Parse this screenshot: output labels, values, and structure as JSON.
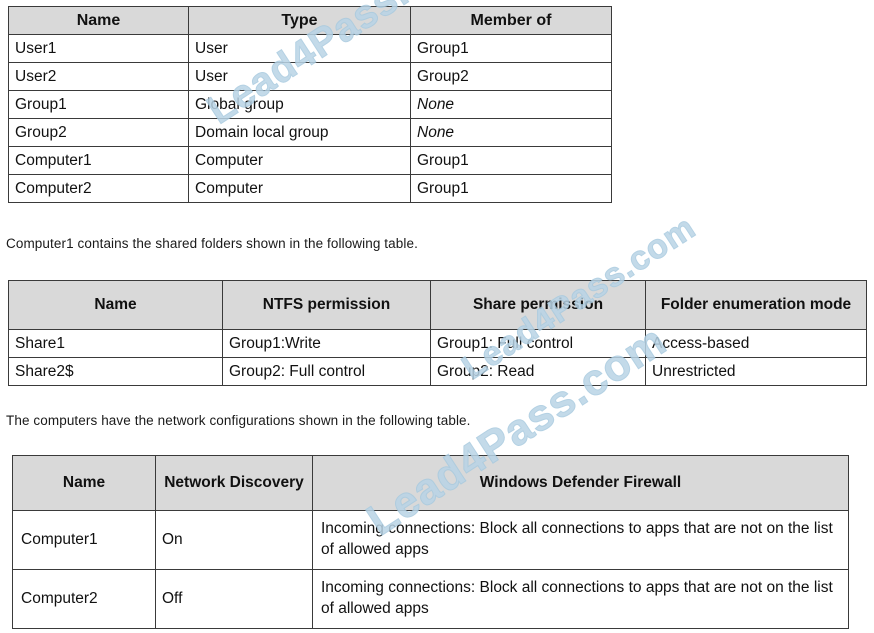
{
  "watermark": {
    "text": "Lead4Pass.com",
    "color": "#b9d4e6"
  },
  "tables": {
    "identities": {
      "headers": [
        "Name",
        "Type",
        "Member of"
      ],
      "rows": [
        {
          "name": "User1",
          "type": "User",
          "member_of": "Group1",
          "member_of_italic": false
        },
        {
          "name": "User2",
          "type": "User",
          "member_of": "Group2",
          "member_of_italic": false
        },
        {
          "name": "Group1",
          "type": "Global group",
          "member_of": "None",
          "member_of_italic": true
        },
        {
          "name": "Group2",
          "type": "Domain local group",
          "member_of": "None",
          "member_of_italic": true
        },
        {
          "name": "Computer1",
          "type": "Computer",
          "member_of": "Group1",
          "member_of_italic": false
        },
        {
          "name": "Computer2",
          "type": "Computer",
          "member_of": "Group1",
          "member_of_italic": false
        }
      ]
    },
    "shares": {
      "headers": [
        "Name",
        "NTFS permission",
        "Share permission",
        "Folder enumeration mode"
      ],
      "rows": [
        {
          "name": "Share1",
          "ntfs": "Group1:Write",
          "share": "Group1: Full control",
          "enumeration": "Access-based"
        },
        {
          "name": "Share2$",
          "ntfs": "Group2: Full control",
          "share": "Group2: Read",
          "enumeration": "Unrestricted"
        }
      ]
    },
    "network": {
      "headers": [
        "Name",
        "Network Discovery",
        "Windows Defender Firewall"
      ],
      "rows": [
        {
          "name": "Computer1",
          "discovery": "On",
          "firewall": "Incoming connections: Block all connections to apps that are not on the list of allowed apps"
        },
        {
          "name": "Computer2",
          "discovery": "Off",
          "firewall": "Incoming connections: Block all connections to apps that are not on the list of allowed apps"
        }
      ]
    }
  },
  "paragraphs": {
    "shared_folders": "Computer1 contains the shared folders shown in the following table.",
    "network_config": "The computers have the network configurations shown in the following table."
  }
}
